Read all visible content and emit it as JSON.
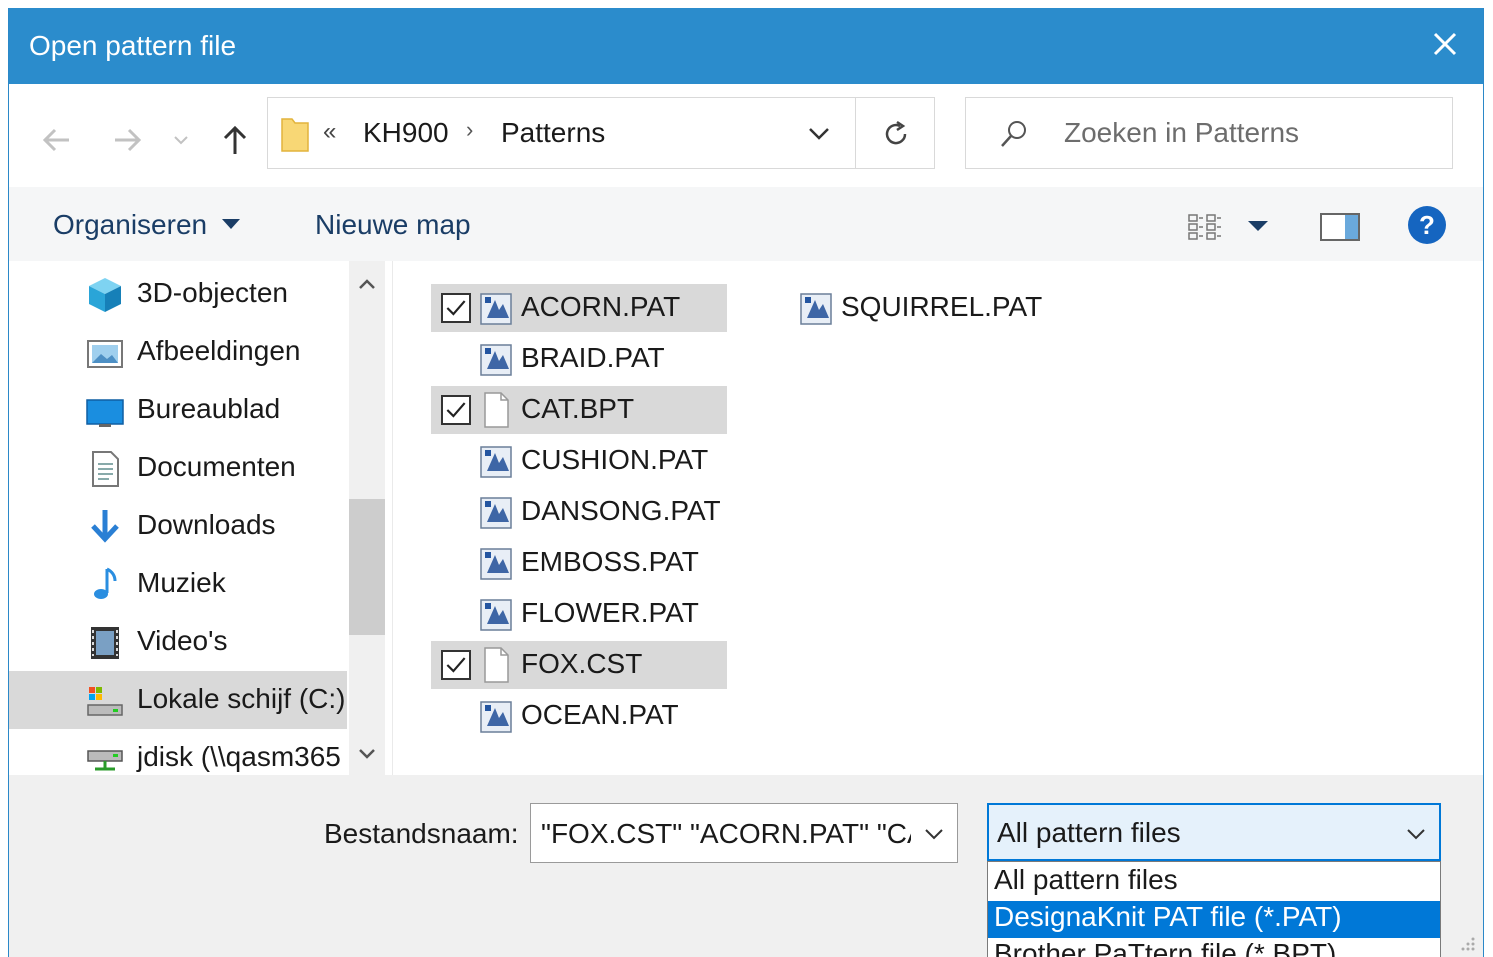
{
  "window": {
    "title": "Open pattern file"
  },
  "address": {
    "overflow": "«",
    "crumbs": [
      "KH900",
      "Patterns"
    ],
    "separator": "›"
  },
  "search": {
    "placeholder": "Zoeken in Patterns"
  },
  "toolbar": {
    "organize": "Organiseren",
    "new_folder": "Nieuwe map"
  },
  "navpane": {
    "items": [
      {
        "label": "3D-objecten",
        "icon": "cube-icon"
      },
      {
        "label": "Afbeeldingen",
        "icon": "pictures-icon"
      },
      {
        "label": "Bureaublad",
        "icon": "desktop-icon"
      },
      {
        "label": "Documenten",
        "icon": "documents-icon"
      },
      {
        "label": "Downloads",
        "icon": "download-icon"
      },
      {
        "label": "Muziek",
        "icon": "music-icon"
      },
      {
        "label": "Video's",
        "icon": "video-icon"
      },
      {
        "label": "Lokale schijf (C:)",
        "icon": "drive-icon"
      },
      {
        "label": "jdisk (\\\\qasm365",
        "icon": "network-drive-icon"
      }
    ],
    "selected_index": 7
  },
  "files": [
    {
      "name": "ACORN.PAT",
      "selected": true
    },
    {
      "name": "BRAID.PAT",
      "selected": false
    },
    {
      "name": "CAT.BPT",
      "selected": true
    },
    {
      "name": "CUSHION.PAT",
      "selected": false
    },
    {
      "name": "DANSONG.PAT",
      "selected": false
    },
    {
      "name": "EMBOSS.PAT",
      "selected": false
    },
    {
      "name": "FLOWER.PAT",
      "selected": false
    },
    {
      "name": "FOX.CST",
      "selected": true
    },
    {
      "name": "OCEAN.PAT",
      "selected": false
    },
    {
      "name": "SQUIRREL.PAT",
      "selected": false
    }
  ],
  "bottom": {
    "filename_label": "Bestandsnaam:",
    "filename_value": "\"FOX.CST\" \"ACORN.PAT\" \"CAT.BPT\"",
    "filetype_selected": "All pattern files",
    "filetype_options": [
      "All pattern files",
      "DesignaKnit PAT file (*.PAT)",
      "Brother PaTtern file (*.BPT)"
    ],
    "highlighted_option": 1
  },
  "colors": {
    "titlebar": "#2b8ccc",
    "selection": "#0078d7",
    "help": "#1565c0"
  }
}
